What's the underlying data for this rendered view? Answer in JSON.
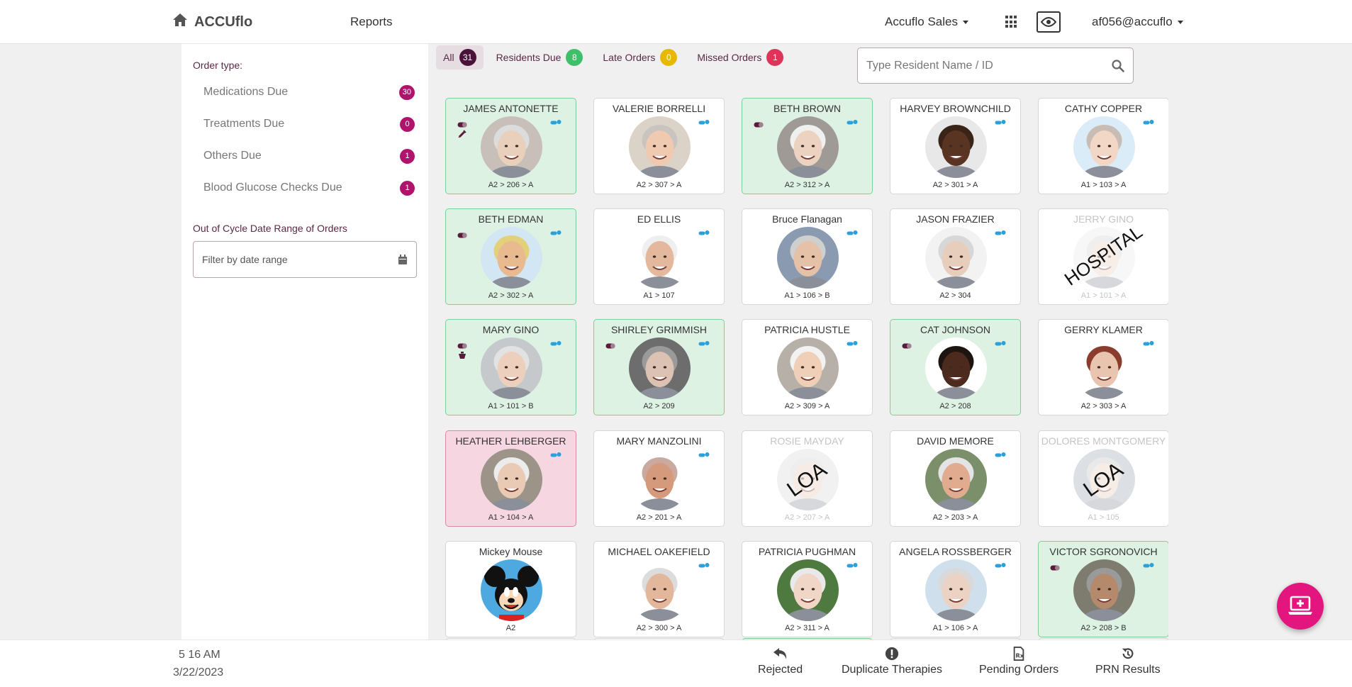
{
  "header": {
    "brand": "ACCUflo",
    "reports": "Reports",
    "facility": "Accuflo Sales",
    "user": "af056@accuflo"
  },
  "sidebar": {
    "order_type_label": "Order type:",
    "order_types": [
      {
        "label": "Medications Due",
        "count": "30"
      },
      {
        "label": "Treatments Due",
        "count": "0"
      },
      {
        "label": "Others Due",
        "count": "1"
      },
      {
        "label": "Blood Glucose Checks Due",
        "count": "1"
      }
    ],
    "ooc_label": "Out of Cycle Date Range of Orders",
    "date_placeholder": "Filter by date range"
  },
  "tabs": [
    {
      "label": "All",
      "count": "31",
      "color": "#4a1238"
    },
    {
      "label": "Residents Due",
      "count": "8",
      "color": "#3fbf6a"
    },
    {
      "label": "Late Orders",
      "count": "0",
      "color": "#e6b800"
    },
    {
      "label": "Missed Orders",
      "count": "1",
      "color": "#e0335a"
    }
  ],
  "search": {
    "placeholder": "Type Resident Name / ID"
  },
  "residents": [
    {
      "name": "JAMES ANTONETTE",
      "loc": "A2 > 206 > A",
      "status": "green",
      "skin": "#e8d0bd",
      "hair": "#dcdcdc",
      "bg": "#c8c0b8",
      "icons": [
        "capsule",
        "syringe"
      ]
    },
    {
      "name": "VALERIE BORRELLI",
      "loc": "A2 > 307 > A",
      "status": "plain",
      "skin": "#efc9b0",
      "hair": "#c9c4bf",
      "bg": "#dcd3c8",
      "icons": []
    },
    {
      "name": "BETH BROWN",
      "loc": "A2 > 312 > A",
      "status": "green",
      "skin": "#ecd2c0",
      "hair": "#f0f0f0",
      "bg": "#9f9a95",
      "icons": [
        "capsule"
      ]
    },
    {
      "name": "HARVEY BROWNCHILD",
      "loc": "A2 > 301 > A",
      "status": "plain",
      "skin": "#5a3423",
      "hair": "#3a2418",
      "bg": "#e8e8e8",
      "icons": []
    },
    {
      "name": "CATHY COPPER",
      "loc": "A1 > 103 > A",
      "status": "plain",
      "skin": "#f2d6c6",
      "hair": "#c8bcb4",
      "bg": "#d9ecf7",
      "icons": []
    },
    {
      "name": "BETH EDMAN",
      "loc": "A2 > 302 > A",
      "status": "green",
      "skin": "#e9b98f",
      "hair": "#e3d07a",
      "bg": "#d3e6f3",
      "icons": [
        "capsule"
      ]
    },
    {
      "name": "ED ELLIS",
      "loc": "A1 > 107",
      "status": "plain",
      "skin": "#e3b89c",
      "hair": "#efefef",
      "bg": "#ffffff",
      "icons": []
    },
    {
      "name": "Bruce Flanagan",
      "loc": "A1 > 106 > B",
      "status": "plain",
      "skin": "#e5c1a8",
      "hair": "#cfcfcf",
      "bg": "#8a9ab0",
      "icons": []
    },
    {
      "name": "JASON FRAZIER",
      "loc": "A2 > 304",
      "status": "plain",
      "skin": "#e7cdbb",
      "hair": "#d7d7d7",
      "bg": "#f2f2f2",
      "icons": []
    },
    {
      "name": "JERRY GINO",
      "loc": "A1 > 101 > A",
      "status": "faded",
      "stamp": "HOSPITAL",
      "skin": "#e8cdbb",
      "hair": "#d0d0d0",
      "bg": "#e8e8e8",
      "icons": []
    },
    {
      "name": "MARY GINO",
      "loc": "A1 > 101 > B",
      "status": "green",
      "skin": "#ecd0bd",
      "hair": "#e2e2e2",
      "bg": "#c5c9cc",
      "icons": [
        "capsule",
        "cup"
      ]
    },
    {
      "name": "SHIRLEY GRIMMISH",
      "loc": "A2 > 209",
      "status": "green",
      "skin": "#dcc2b2",
      "hair": "#9a9a9a",
      "bg": "#6d6d6d",
      "icons": [
        "capsule"
      ]
    },
    {
      "name": "PATRICIA HUSTLE",
      "loc": "A2 > 309 > A",
      "status": "plain",
      "skin": "#efcfb8",
      "hair": "#f2f2f2",
      "bg": "#b7b0a8",
      "icons": []
    },
    {
      "name": "CAT JOHNSON",
      "loc": "A2 > 208",
      "status": "green",
      "skin": "#4c2a1d",
      "hair": "#1e1410",
      "bg": "#ffffff",
      "icons": [
        "capsule"
      ]
    },
    {
      "name": "GERRY KLAMER",
      "loc": "A2 > 303 > A",
      "status": "plain",
      "skin": "#e9c4ae",
      "hair": "#8a3c2e",
      "bg": "#ffffff",
      "icons": []
    },
    {
      "name": "HEATHER LEHBERGER",
      "loc": "A1 > 104 > A",
      "status": "red",
      "skin": "#e9cab5",
      "hair": "#ececec",
      "bg": "#9c9488",
      "icons": []
    },
    {
      "name": "MARY MANZOLINI",
      "loc": "A2 > 201 > A",
      "status": "plain",
      "skin": "#d59a7c",
      "hair": "#c9a9a0",
      "bg": "#ffffff",
      "icons": []
    },
    {
      "name": "ROSIE MAYDAY",
      "loc": "A2 > 207 > A",
      "status": "faded",
      "stamp": "LOA",
      "skin": "#e6c9b5",
      "hair": "#cfcfcf",
      "bg": "#d6d6d6",
      "icons": []
    },
    {
      "name": "DAVID MEMORE",
      "loc": "A2 > 203 > A",
      "status": "plain",
      "skin": "#e0ab8e",
      "hair": "#e4e4e4",
      "bg": "#7a8f6a",
      "icons": []
    },
    {
      "name": "DOLORES MONTGOMERY",
      "loc": "A1 > 105",
      "status": "faded",
      "stamp": "LOA",
      "skin": "#e6cbbb",
      "hair": "#bfbfbf",
      "bg": "#9aa7b3",
      "icons": []
    },
    {
      "name": "Mickey Mouse",
      "loc": "A2",
      "status": "plain",
      "mouse": true,
      "skin": "#f7d9b9",
      "hair": "#111111",
      "bg": "#4da9e0",
      "icons": []
    },
    {
      "name": "MICHAEL OAKEFIELD",
      "loc": "A2 > 300 > A",
      "status": "plain",
      "skin": "#e2b79c",
      "hair": "#dcdcdc",
      "bg": "#ffffff",
      "icons": []
    },
    {
      "name": "PATRICIA PUGHMAN",
      "loc": "A2 > 311 > A",
      "status": "plain",
      "skin": "#f0d6c6",
      "hair": "#e9e9e9",
      "bg": "#4f7a3f",
      "icons": []
    },
    {
      "name": "ANGELA ROSSBERGER",
      "loc": "A1 > 106 > A",
      "status": "plain",
      "skin": "#ecd2c2",
      "hair": "#d9d9d9",
      "bg": "#cfe0ec",
      "icons": []
    },
    {
      "name": "VICTOR SGRONOVICH",
      "loc": "A2 > 208 > B",
      "status": "green",
      "skin": "#b58a6c",
      "hair": "#9a9a9a",
      "bg": "#7e7c6f",
      "icons": [
        "capsule"
      ]
    }
  ],
  "next_row_status": [
    "plain",
    "plain",
    "green",
    "plain",
    "plain"
  ],
  "footer": {
    "time": "5 16 AM",
    "date": "3/22/2023",
    "buttons": [
      {
        "label": "Rejected",
        "icon": "undo-icon"
      },
      {
        "label": "Duplicate Therapies",
        "icon": "alert-icon"
      },
      {
        "label": "Pending Orders",
        "icon": "rx-document-icon"
      },
      {
        "label": "PRN Results",
        "icon": "history-icon"
      }
    ]
  },
  "colors": {
    "accent": "#b0136c",
    "fab": "#e3157e",
    "green_card": "#ddf2e3",
    "red_card": "#f6d7e1"
  }
}
